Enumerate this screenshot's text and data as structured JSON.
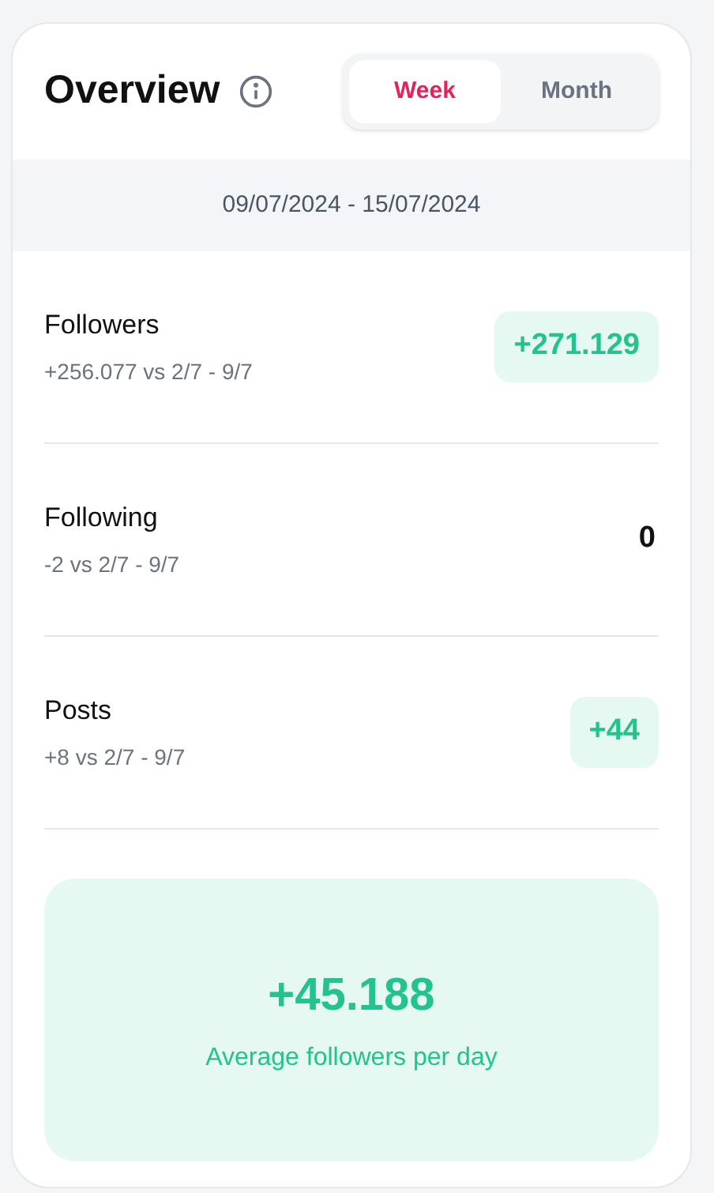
{
  "header": {
    "title": "Overview"
  },
  "tabs": [
    {
      "label": "Week",
      "selected": true
    },
    {
      "label": "Month",
      "selected": false
    }
  ],
  "date_range": "09/07/2024 - 15/07/2024",
  "stats": [
    {
      "label": "Followers",
      "comparison": "+256.077 vs 2/7 - 9/7",
      "value": "+271.129",
      "kind": "badge"
    },
    {
      "label": "Following",
      "comparison": "-2 vs 2/7 - 9/7",
      "value": "0",
      "kind": "plain"
    },
    {
      "label": "Posts",
      "comparison": "+8 vs 2/7 - 9/7",
      "value": "+44",
      "kind": "badge"
    }
  ],
  "summary": {
    "value": "+45.188",
    "caption": "Average followers per day"
  }
}
